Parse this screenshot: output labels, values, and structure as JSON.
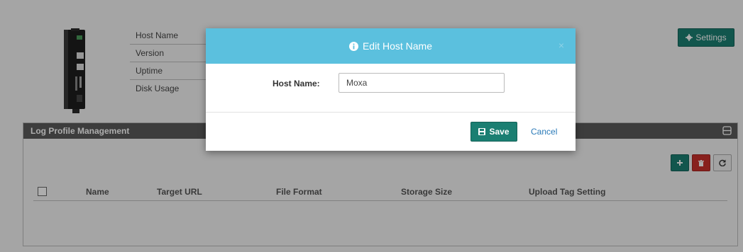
{
  "device": {
    "info_labels": [
      "Host Name",
      "Version",
      "Uptime",
      "Disk Usage"
    ],
    "settings_label": "Settings"
  },
  "log_panel": {
    "title": "Log Profile Management",
    "columns": [
      "Name",
      "Target URL",
      "File Format",
      "Storage Size",
      "Upload Tag Setting"
    ]
  },
  "modal": {
    "title": "Edit Host Name",
    "field_label": "Host Name:",
    "field_value": "Moxa",
    "save_label": "Save",
    "cancel_label": "Cancel"
  },
  "colors": {
    "modal_header": "#5bc0de",
    "primary_button": "#1b7f72",
    "delete_button": "#c9302c"
  }
}
